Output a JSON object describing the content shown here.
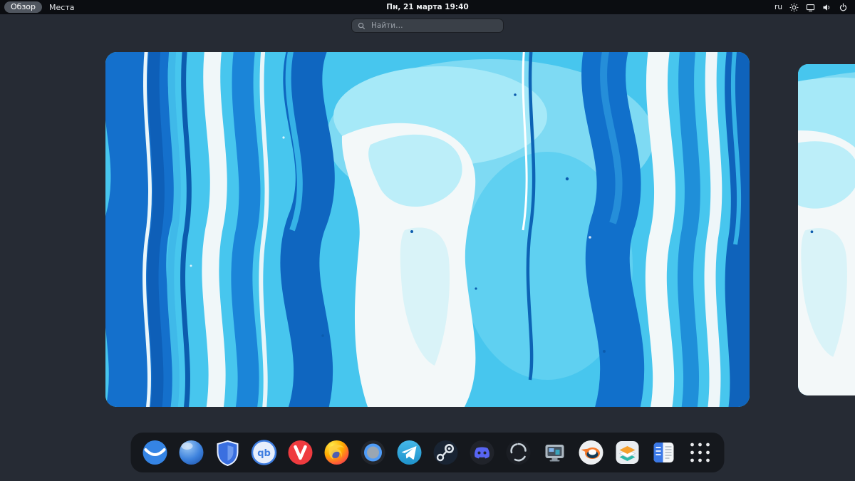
{
  "topbar": {
    "activities": "Обзор",
    "places": "Места",
    "clock": "Пн, 21 марта  19:40",
    "keyboard_layout": "ru",
    "status_icons": [
      "brightness-icon",
      "screencast-icon",
      "volume-icon",
      "power-icon"
    ]
  },
  "search": {
    "placeholder": "Найти…",
    "icon": "search-icon"
  },
  "workspaces": {
    "visible": 2,
    "wallpaper": {
      "style": "abstract marbled liquid paint",
      "colors": {
        "base_cyan": "#47c6ee",
        "deep_blue": "#1470cc",
        "navy": "#0e5fb8",
        "white": "#f3f8f9",
        "pale_cyan": "#a6e9f8"
      }
    }
  },
  "dock": {
    "qb_label": "qb",
    "items": [
      {
        "icon": "web-browser-icon"
      },
      {
        "icon": "globe-browser-icon"
      },
      {
        "icon": "bitwarden-shield-icon"
      },
      {
        "icon": "qbittorrent-icon"
      },
      {
        "icon": "vivaldi-icon"
      },
      {
        "icon": "firefox-icon"
      },
      {
        "icon": "blue-ring-app-icon"
      },
      {
        "icon": "telegram-icon"
      },
      {
        "icon": "steam-icon"
      },
      {
        "icon": "discord-icon"
      },
      {
        "icon": "swirl-app-icon"
      },
      {
        "icon": "virtual-machine-icon"
      },
      {
        "icon": "blender-icon"
      },
      {
        "icon": "layers-app-icon"
      },
      {
        "icon": "document-app-icon"
      },
      {
        "icon": "show-apps-grid-icon"
      }
    ]
  }
}
